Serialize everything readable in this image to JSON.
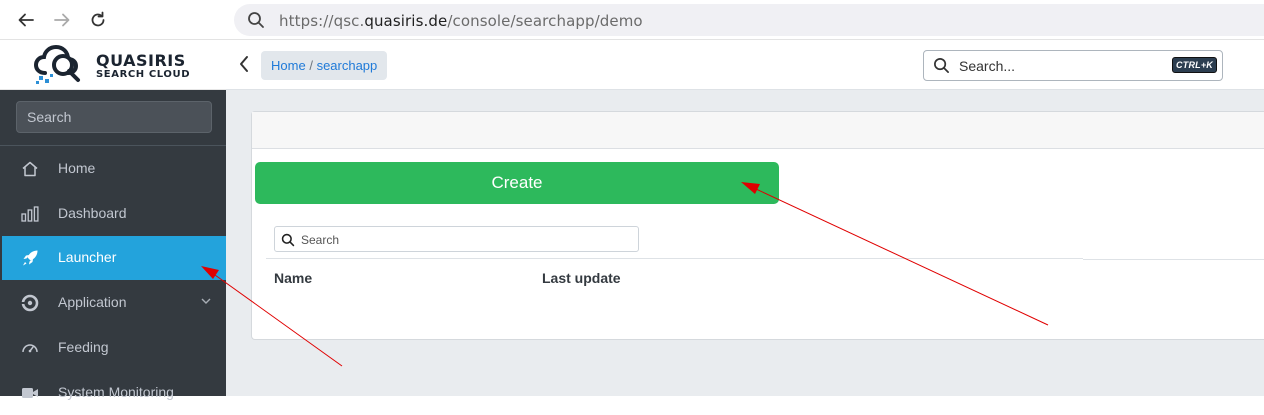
{
  "browser": {
    "url_prefix": "https://qsc.",
    "url_domain": "quasiris.de",
    "url_path": "/console/searchapp/demo"
  },
  "brand": {
    "name": "QUASIRIS",
    "subtitle": "SEARCH CLOUD"
  },
  "sidebar": {
    "search_placeholder": "Search",
    "items": [
      {
        "label": "Home",
        "icon": "home-icon"
      },
      {
        "label": "Dashboard",
        "icon": "bar-chart-icon"
      },
      {
        "label": "Launcher",
        "icon": "rocket-icon",
        "active": true
      },
      {
        "label": "Application",
        "icon": "application-icon",
        "expandable": true
      },
      {
        "label": "Feeding",
        "icon": "gauge-icon"
      },
      {
        "label": "System Monitoring",
        "icon": "video-icon"
      }
    ]
  },
  "header": {
    "breadcrumb_home": "Home",
    "breadcrumb_sep": "/",
    "breadcrumb_current": "searchapp",
    "search_placeholder": "Search...",
    "shortcut": "CTRL+K"
  },
  "main": {
    "create_label": "Create",
    "list_search_placeholder": "Search",
    "columns": [
      "Name",
      "Last update"
    ]
  },
  "colors": {
    "sidebar_bg": "#343a40",
    "active_item": "#23a3dc",
    "create_button": "#2db95c",
    "link": "#1f7ad8",
    "annotation_arrow": "#e00000"
  }
}
